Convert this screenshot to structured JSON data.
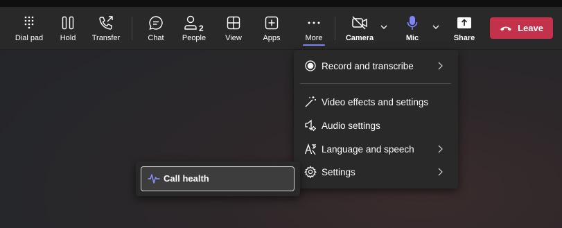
{
  "toolbar": {
    "dial_pad": "Dial pad",
    "hold": "Hold",
    "transfer": "Transfer",
    "chat": "Chat",
    "people": "People",
    "people_count": "2",
    "view": "View",
    "apps": "Apps",
    "more": "More",
    "camera": "Camera",
    "mic": "Mic",
    "share": "Share",
    "leave": "Leave"
  },
  "more_menu": {
    "items": [
      {
        "label": "Record and transcribe",
        "icon": "record-icon",
        "has_submenu": true
      },
      {
        "label": "Video effects and settings",
        "icon": "magic-wand-icon",
        "has_submenu": false
      },
      {
        "label": "Audio settings",
        "icon": "speaker-settings-icon",
        "has_submenu": false
      },
      {
        "label": "Language and speech",
        "icon": "language-icon",
        "has_submenu": true
      },
      {
        "label": "Settings",
        "icon": "gear-icon",
        "has_submenu": true
      }
    ]
  },
  "settings_submenu": {
    "items": [
      {
        "label": "Call health",
        "icon": "pulse-icon"
      }
    ]
  },
  "colors": {
    "toolbar_bg": "#292929",
    "leave_red": "#c4314b",
    "accent": "#7f85f5",
    "menu_bg": "#292929"
  }
}
